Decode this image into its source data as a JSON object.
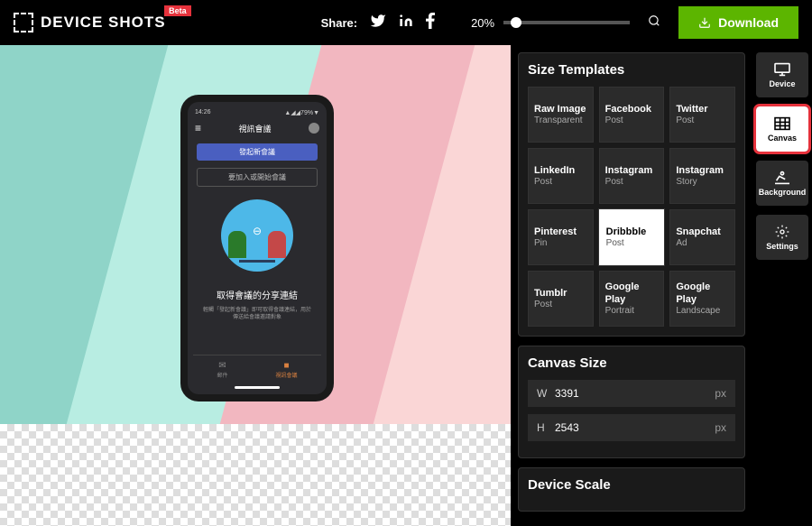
{
  "header": {
    "app_name": "DEVICE SHOTS",
    "beta": "Beta",
    "share_label": "Share:",
    "zoom": "20%",
    "download": "Download"
  },
  "phone": {
    "time": "14:26",
    "signal": "▲◢◢79%▼",
    "title": "視訊會議",
    "btn1": "發起新會議",
    "btn2": "要加入或開始會議",
    "heading": "取得會議的分享連結",
    "desc": "輕觸「發起新會議」即可取得會議連結，用於傳送給會議邀請對象",
    "tab1": "郵件",
    "tab2": "視訊會議"
  },
  "panel": {
    "templates_title": "Size Templates",
    "canvas_size_title": "Canvas Size",
    "device_scale_title": "Device Scale",
    "width_label": "W",
    "height_label": "H",
    "width_val": "3391",
    "height_val": "2543",
    "unit": "px",
    "templates": [
      {
        "t": "Raw Image",
        "s": "Transparent"
      },
      {
        "t": "Facebook",
        "s": "Post"
      },
      {
        "t": "Twitter",
        "s": "Post"
      },
      {
        "t": "LinkedIn",
        "s": "Post"
      },
      {
        "t": "Instagram",
        "s": "Post"
      },
      {
        "t": "Instagram",
        "s": "Story"
      },
      {
        "t": "Pinterest",
        "s": "Pin"
      },
      {
        "t": "Dribbble",
        "s": "Post"
      },
      {
        "t": "Snapchat",
        "s": "Ad"
      },
      {
        "t": "Tumblr",
        "s": "Post"
      },
      {
        "t": "Google Play",
        "s": "Portrait"
      },
      {
        "t": "Google Play",
        "s": "Landscape"
      }
    ]
  },
  "tabs": {
    "device": "Device",
    "canvas": "Canvas",
    "background": "Background",
    "settings": "Settings"
  }
}
